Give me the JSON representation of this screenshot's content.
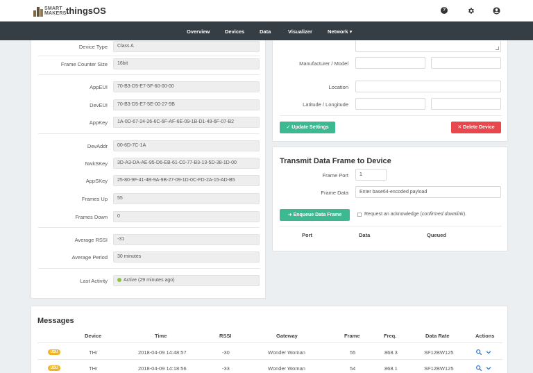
{
  "header": {
    "logo_line1": "SMART",
    "logo_line2": "MAKERS",
    "app_name": "thingsOS",
    "icons": [
      "help-icon",
      "gear-icon",
      "user-icon"
    ]
  },
  "nav": {
    "items": [
      "Overview",
      "Devices",
      "Data",
      "Visualizer",
      "Network ▾"
    ]
  },
  "device": {
    "fields": [
      {
        "label": "Device Type",
        "value": "Class A"
      },
      {
        "label": "Frame Counter Size",
        "value": "16bit"
      },
      {
        "label": "AppEUI",
        "value": "70-B3-D5-E7-5F-60-00-00"
      },
      {
        "label": "DevEUI",
        "value": "70-B3-D5-E7-5E-00-27-9B"
      },
      {
        "label": "AppKey",
        "value": "1A-0D-67-24-26-6C-6F-AF-6E-09-1B-D1-49-6F-07-B2"
      },
      {
        "label": "DevAddr",
        "value": "00-6D-7C-1A"
      },
      {
        "label": "NwkSKey",
        "value": "3D-A3-DA-AE-95-D6-EB-61-C0-77-B3-13-5D-38-1D-00"
      },
      {
        "label": "AppSKey",
        "value": "25-80-9F-41-4B-9A-9B-27-09-1D-0C-FD-2A-15-AD-B5"
      },
      {
        "label": "Frames Up",
        "value": "55"
      },
      {
        "label": "Frames Down",
        "value": "0"
      },
      {
        "label": "Average RSSI",
        "value": "-31"
      },
      {
        "label": "Average Period",
        "value": "30 minutes"
      },
      {
        "label": "Last Activity",
        "value": "Active (29 minutes ago)"
      }
    ]
  },
  "settings": {
    "manufacturer_label": "Manufacturer / Model",
    "location_label": "Location",
    "latlng_label": "Latitude / Longitude",
    "update_button": "✓ Update Settings",
    "delete_button": "✕ Delete Device"
  },
  "transmit": {
    "title": "Transmit Data Frame to Device",
    "frame_port_label": "Frame Port",
    "frame_port_value": "1",
    "frame_data_label": "Frame Data",
    "frame_data_placeholder": "Enter base64-encoded payload",
    "enqueue_button": "➜ Enqueue Data Frame",
    "ack_label": "Request an acknowledge (confirmed downlink).",
    "columns": [
      "Port",
      "Data",
      "Queued"
    ]
  },
  "messages": {
    "title": "Messages",
    "columns": [
      "Device",
      "Time",
      "RSSI",
      "Gateway",
      "Frame",
      "Freq.",
      "Data Rate",
      "Actions"
    ],
    "rows": [
      {
        "badge": "UDU",
        "device": "THr",
        "time": "2018-04-09 14:48:57",
        "rssi": "-30",
        "gateway": "Wonder Woman",
        "frame": "55",
        "freq": "868.3",
        "rate": "SF12BW125"
      },
      {
        "badge": "UDU",
        "device": "THr",
        "time": "2018-04-09 14:18:56",
        "rssi": "-33",
        "gateway": "Wonder Woman",
        "frame": "54",
        "freq": "868.1",
        "rate": "SF12BW125"
      }
    ]
  },
  "colors": {
    "nav_bg": "#353d45",
    "accent_green": "#3cb990",
    "danger_red": "#e8474d",
    "badge_yellow": "#f0b429",
    "status_green": "#8bc34a",
    "action_blue": "#2b7bd6"
  }
}
